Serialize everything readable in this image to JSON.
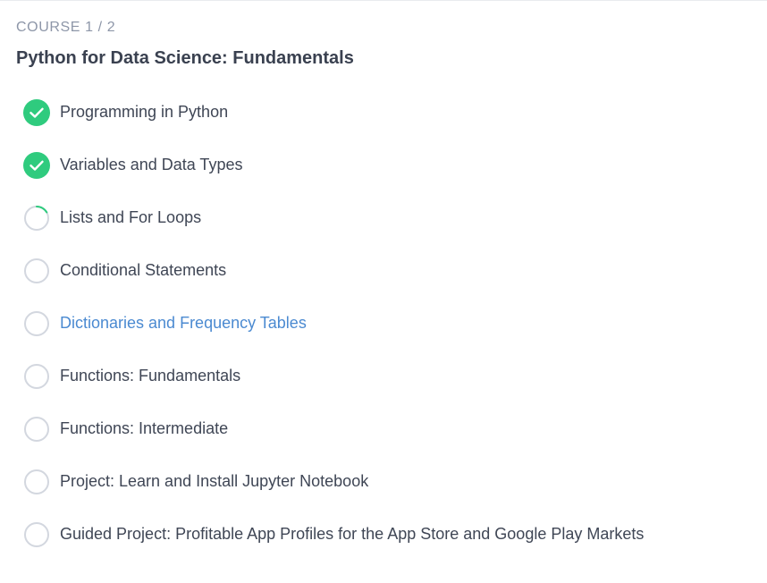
{
  "course": {
    "kicker": "COURSE 1 / 2",
    "title": "Python for Data Science: Fundamentals"
  },
  "colors": {
    "complete": "#2fcb7e",
    "pending_ring": "#d3d7df",
    "progress_arc": "#2fcb7e",
    "active_link": "#4b8ad1"
  },
  "lessons": [
    {
      "label": "Programming in Python",
      "status": "complete",
      "icon": "check-circle-icon"
    },
    {
      "label": "Variables and Data Types",
      "status": "complete",
      "icon": "check-circle-icon"
    },
    {
      "label": "Lists and For Loops",
      "status": "in-progress",
      "icon": "progress-ring-icon"
    },
    {
      "label": "Conditional Statements",
      "status": "not-started",
      "icon": "empty-circle-icon"
    },
    {
      "label": "Dictionaries and Frequency Tables",
      "status": "current",
      "icon": "empty-circle-icon"
    },
    {
      "label": "Functions: Fundamentals",
      "status": "not-started",
      "icon": "empty-circle-icon"
    },
    {
      "label": "Functions: Intermediate",
      "status": "not-started",
      "icon": "empty-circle-icon"
    },
    {
      "label": "Project: Learn and Install Jupyter Notebook",
      "status": "not-started",
      "icon": "empty-circle-icon"
    },
    {
      "label": "Guided Project: Profitable App Profiles for the App Store and Google Play Markets",
      "status": "not-started",
      "icon": "empty-circle-icon"
    }
  ]
}
